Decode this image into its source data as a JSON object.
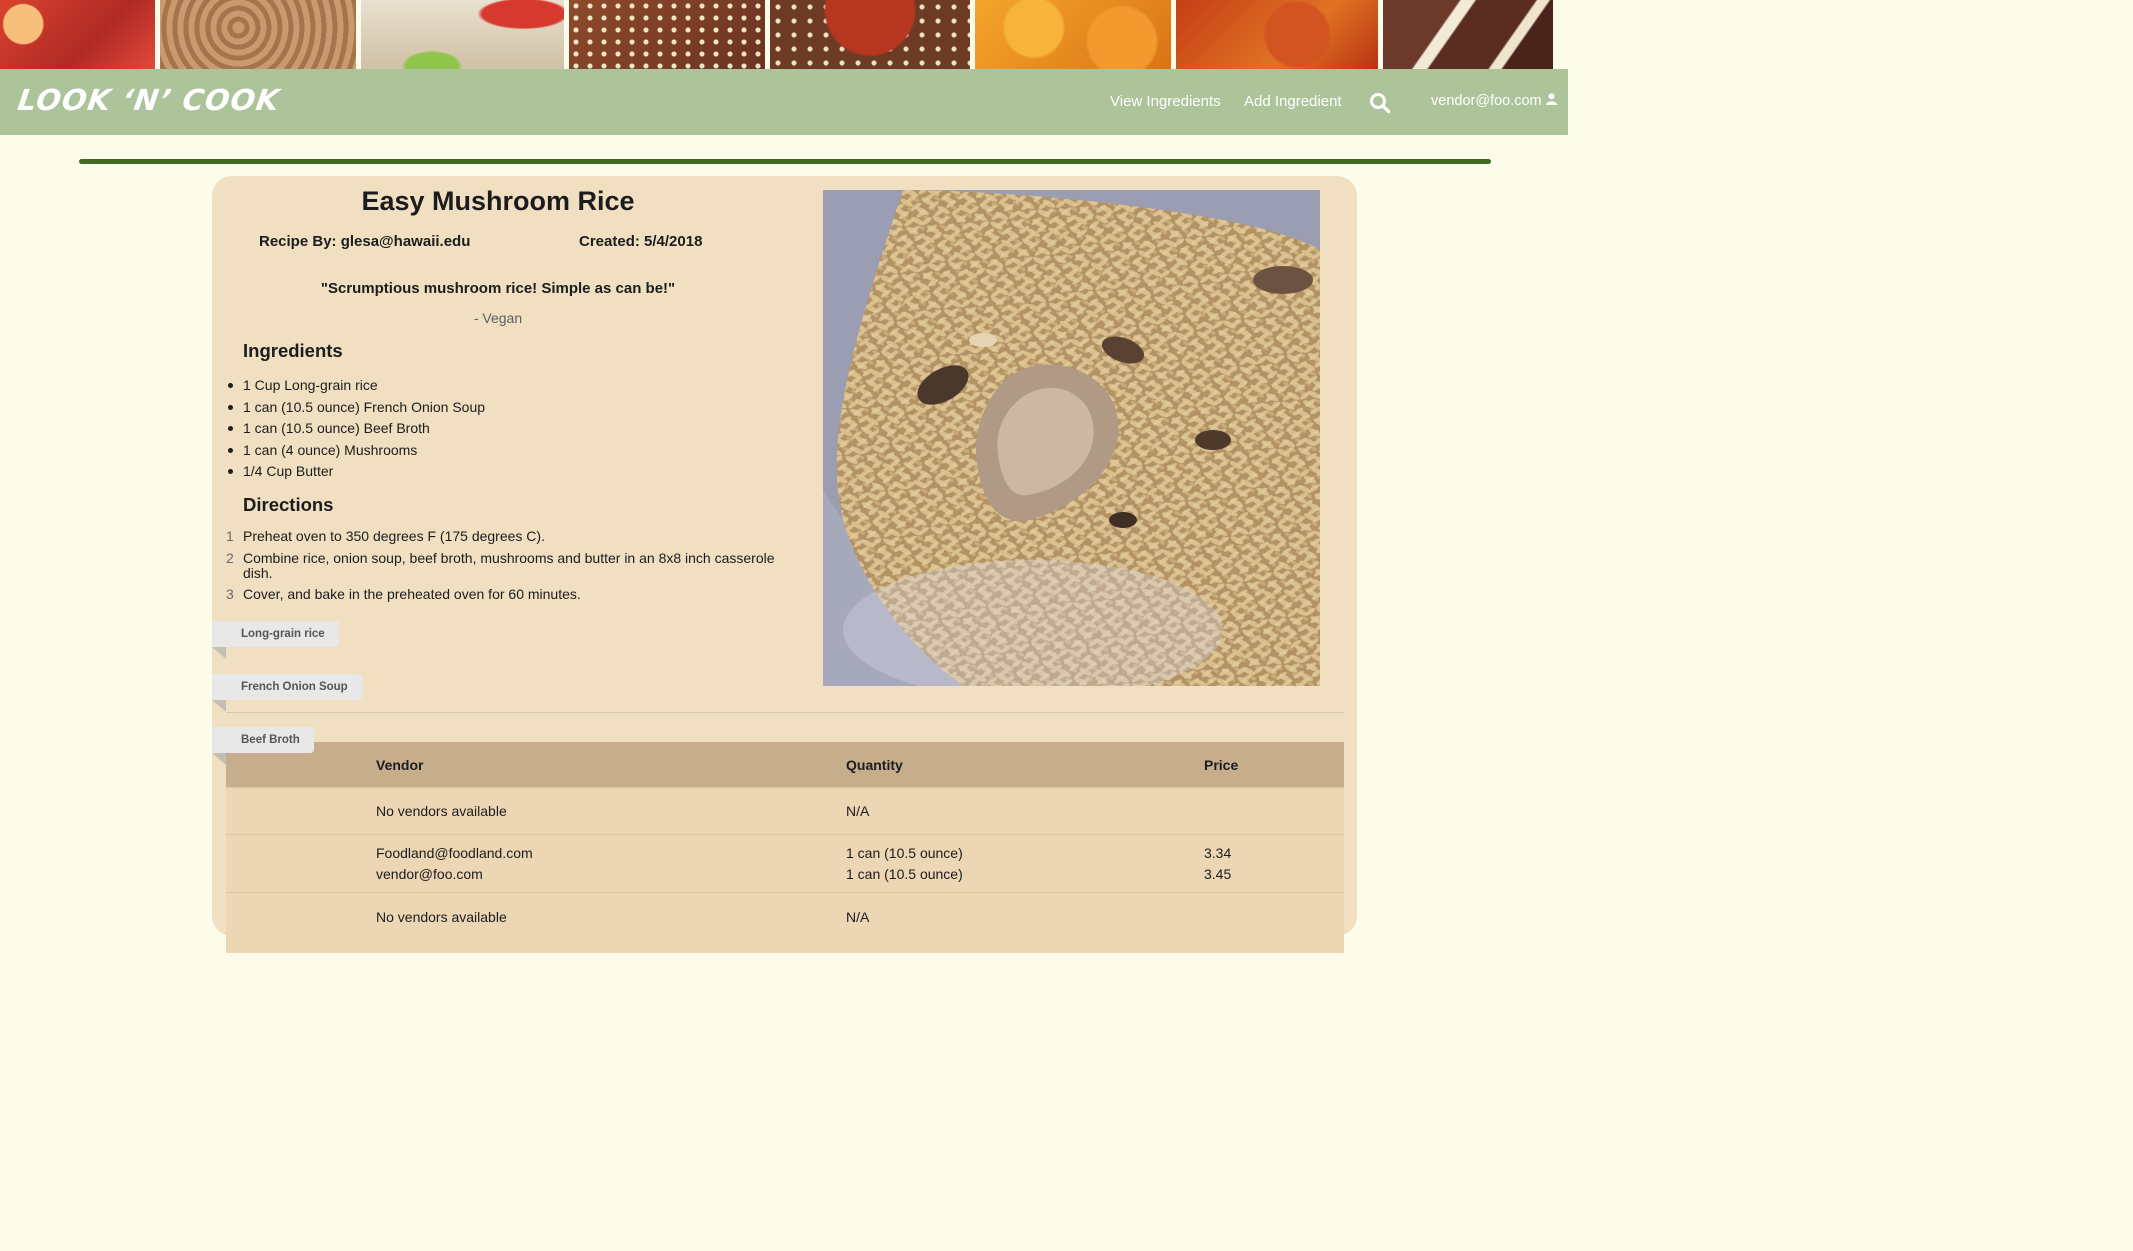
{
  "brand": {
    "logo_text": "LOOK ‘N’ COOK"
  },
  "nav": {
    "view_ingredients": "View Ingredients",
    "add_ingredient": "Add Ingredient",
    "user_email": "vendor@foo.com"
  },
  "recipe": {
    "title": "Easy Mushroom Rice",
    "recipe_by": "Recipe By: glesa@hawaii.edu",
    "created": "Created: 5/4/2018",
    "quote": "\"Scrumptious mushroom rice! Simple as can be!\"",
    "tags": "- Vegan",
    "ingredients_heading": "Ingredients",
    "ingredients": [
      "1 Cup Long-grain rice",
      "1 can (10.5 ounce) French Onion Soup",
      "1 can (10.5 ounce) Beef Broth",
      "1 can (4 ounce) Mushrooms",
      "1/4 Cup Butter"
    ],
    "directions_heading": "Directions",
    "directions": [
      {
        "num": "1",
        "text": "Preheat oven to 350 degrees F (175 degrees C)."
      },
      {
        "num": "2",
        "text": "Combine rice, onion soup, beef broth, mushrooms and butter in an 8x8 inch casserole dish."
      },
      {
        "num": "3",
        "text": "Cover, and bake in the preheated oven for 60 minutes."
      }
    ]
  },
  "vendor_table": {
    "headers": {
      "vendor": "Vendor",
      "quantity": "Quantity",
      "price": "Price"
    },
    "rows": [
      {
        "ingredient": "Long-grain rice",
        "vendors": [
          "No vendors available"
        ],
        "quantities": [
          "N/A"
        ],
        "prices": []
      },
      {
        "ingredient": "French Onion Soup",
        "vendors": [
          "Foodland@foodland.com",
          "vendor@foo.com"
        ],
        "quantities": [
          "1 can (10.5 ounce)",
          "1 can (10.5 ounce)"
        ],
        "prices": [
          "3.34",
          "3.45"
        ]
      },
      {
        "ingredient": "Beef Broth",
        "vendors": [
          "No vendors available"
        ],
        "quantities": [
          "N/A"
        ],
        "prices": []
      }
    ]
  },
  "colors": {
    "navbar": "#adc49b",
    "page_background": "#fdfbe9",
    "card": "#f1dfc2",
    "accent_rule": "#3e6b1e",
    "table_header": "#c6ad8c",
    "table_row": "#ecd6b3"
  },
  "icons": {
    "search": "search-icon",
    "user": "user-icon"
  }
}
